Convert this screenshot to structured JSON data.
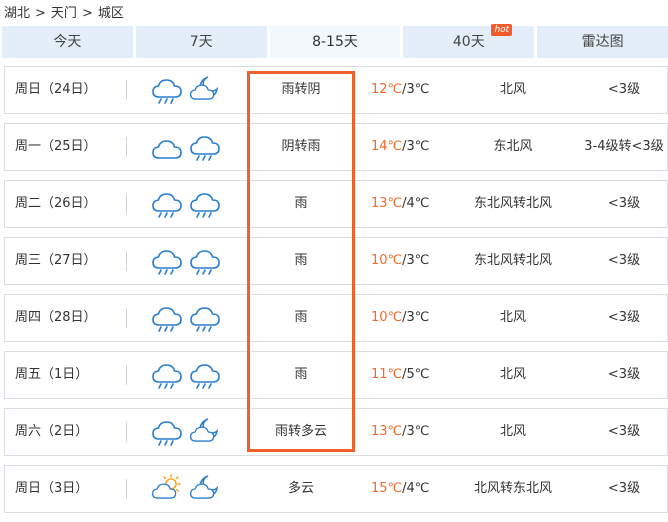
{
  "breadcrumb": {
    "province": "湖北",
    "city": "天门",
    "district": "城区",
    "separator": ">"
  },
  "tabs": [
    {
      "label": "今天",
      "active": false
    },
    {
      "label": "7天",
      "active": false
    },
    {
      "label": "8-15天",
      "active": true
    },
    {
      "label": "40天",
      "active": false,
      "badge": "hot"
    },
    {
      "label": "雷达图",
      "active": false
    }
  ],
  "colors": {
    "accent_temp": "#f26b28",
    "highlight_box": "#f0602b",
    "tab_bg": "#e3eef9",
    "icon_blue": "#2a7fcf",
    "icon_orange": "#f5a623"
  },
  "rows": [
    {
      "day": "周日（24日）",
      "icons": [
        "rain-cloud-icon",
        "cloudy-night-icon"
      ],
      "desc": "雨转阴",
      "high": "12℃",
      "low": "/3℃",
      "wind": "北风",
      "level": "<3级"
    },
    {
      "day": "周一（25日）",
      "icons": [
        "overcast-cloud-icon",
        "rain-cloud-icon"
      ],
      "desc": "阴转雨",
      "high": "14℃",
      "low": "/3℃",
      "wind": "东北风",
      "level": "3-4级转<3级"
    },
    {
      "day": "周二（26日）",
      "icons": [
        "rain-cloud-icon",
        "rain-cloud-icon"
      ],
      "desc": "雨",
      "high": "13℃",
      "low": "/4℃",
      "wind": "东北风转北风",
      "level": "<3级"
    },
    {
      "day": "周三（27日）",
      "icons": [
        "rain-cloud-icon",
        "rain-cloud-icon"
      ],
      "desc": "雨",
      "high": "10℃",
      "low": "/3℃",
      "wind": "东北风转北风",
      "level": "<3级"
    },
    {
      "day": "周四（28日）",
      "icons": [
        "rain-cloud-icon",
        "rain-cloud-icon"
      ],
      "desc": "雨",
      "high": "10℃",
      "low": "/3℃",
      "wind": "北风",
      "level": "<3级"
    },
    {
      "day": "周五（1日）",
      "icons": [
        "rain-cloud-icon",
        "rain-cloud-icon"
      ],
      "desc": "雨",
      "high": "11℃",
      "low": "/5℃",
      "wind": "北风",
      "level": "<3级"
    },
    {
      "day": "周六（2日）",
      "icons": [
        "rain-cloud-icon",
        "cloudy-night-icon"
      ],
      "desc": "雨转多云",
      "high": "13℃",
      "low": "/3℃",
      "wind": "北风",
      "level": "<3级"
    },
    {
      "day": "周日（3日）",
      "icons": [
        "sunny-cloud-icon",
        "cloudy-night-icon"
      ],
      "desc": "多云",
      "high": "15℃",
      "low": "/4℃",
      "wind": "北风转东北风",
      "level": "<3级"
    }
  ]
}
